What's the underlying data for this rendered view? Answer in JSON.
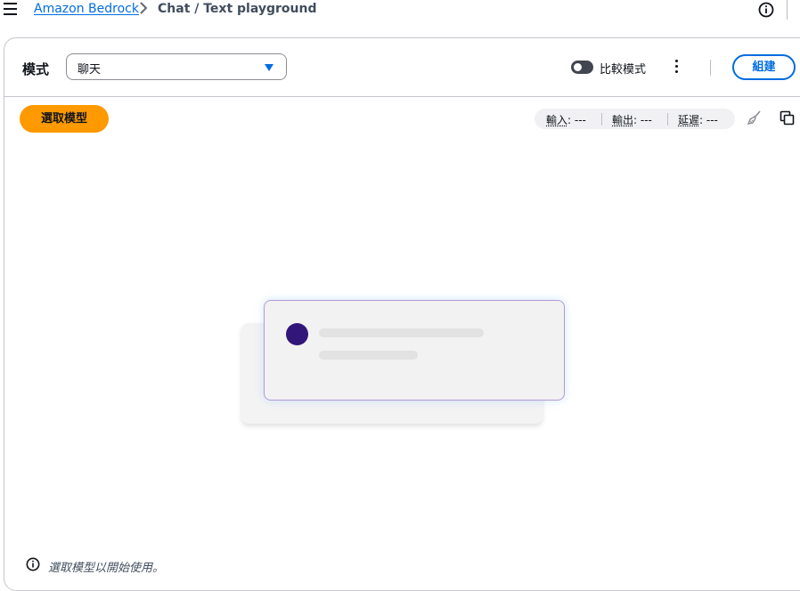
{
  "breadcrumb": {
    "service_link": "Amazon Bedrock",
    "current": "Chat / Text playground"
  },
  "icons": {
    "menu": "hamburger-icon",
    "breadcrumb_separator": "chevron-right-icon",
    "info": "info-icon",
    "more": "vertical-ellipsis-icon",
    "clear": "broom-icon",
    "copy": "copy-icon"
  },
  "header": {
    "mode_label": "模式",
    "mode_value": "聊天",
    "compare_label": "比較模式",
    "compare_enabled": false,
    "build_label": "組建"
  },
  "toolbar": {
    "select_model_label": "選取模型",
    "metrics": [
      {
        "key": "輸入",
        "value": ": ---"
      },
      {
        "key": "輸出",
        "value": ": ---"
      },
      {
        "key": "延遲",
        "value": ": ---"
      }
    ]
  },
  "hint": {
    "text": "選取模型以開始使用。"
  },
  "colors": {
    "accent_orange": "#ff9900",
    "link_blue": "#006ce0",
    "avatar_purple": "#33167a"
  }
}
